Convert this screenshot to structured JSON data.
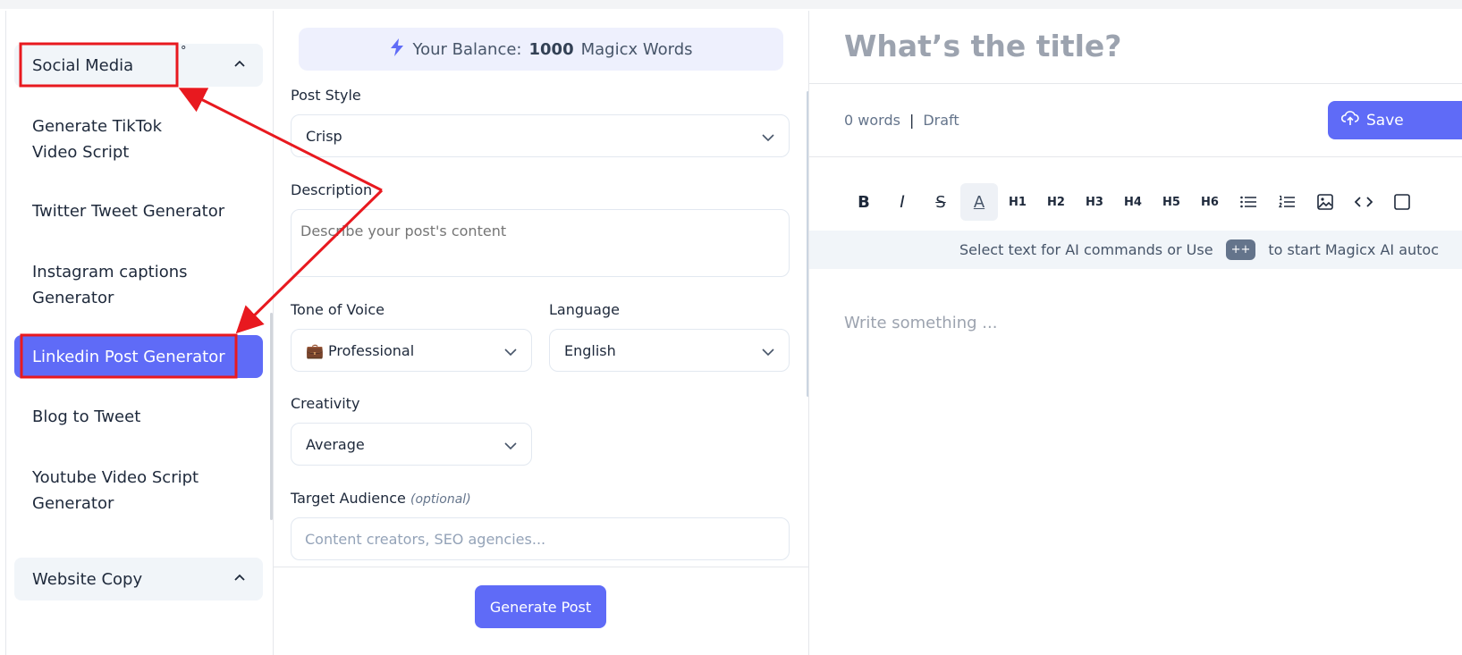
{
  "sidebar": {
    "groups": [
      {
        "label": "Social Media",
        "degree_mark": "°"
      },
      {
        "label": "Website Copy"
      }
    ],
    "items": [
      {
        "label": "Generate TikTok Video Script"
      },
      {
        "label": "Twitter Tweet Generator"
      },
      {
        "label": "Instagram captions Generator"
      },
      {
        "label": "Linkedin Post Generator",
        "active": true
      },
      {
        "label": "Blog to Tweet"
      },
      {
        "label": "Youtube Video Script Generator"
      }
    ]
  },
  "form": {
    "balance": {
      "prefix": "Your Balance:",
      "amount": "1000",
      "suffix": "Magicx Words"
    },
    "post_style": {
      "label": "Post Style",
      "value": "Crisp"
    },
    "description": {
      "label": "Description",
      "placeholder": "Describe your post's content"
    },
    "tone": {
      "label": "Tone of Voice",
      "emoji": "💼",
      "value": "Professional"
    },
    "language": {
      "label": "Language",
      "value": "English"
    },
    "creativity": {
      "label": "Creativity",
      "value": "Average"
    },
    "audience": {
      "label": "Target Audience",
      "optional": "(optional)",
      "placeholder": "Content creators, SEO agencies..."
    },
    "generate_label": "Generate Post"
  },
  "editor": {
    "title_placeholder": "What’s the title?",
    "word_count": "0 words",
    "separator": "|",
    "status": "Draft",
    "save_label": "Save",
    "toolbar": [
      "B",
      "I",
      "S",
      "A",
      "H1",
      "H2",
      "H3",
      "H4",
      "H5",
      "H6"
    ],
    "hint_left": "Select text for AI commands or Use",
    "hint_key": "++",
    "hint_right": "to start Magicx AI autoc",
    "body_placeholder": "Write something ..."
  },
  "colors": {
    "accent": "#5f6bf7",
    "annotation": "#e8191f"
  }
}
